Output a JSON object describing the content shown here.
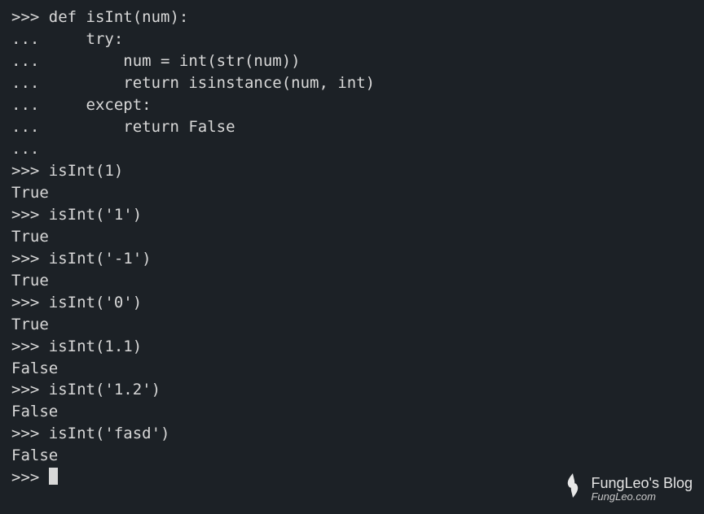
{
  "terminal": {
    "lines": [
      ">>> def isInt(num):",
      "...     try:",
      "...         num = int(str(num))",
      "...         return isinstance(num, int)",
      "...     except:",
      "...         return False",
      "...",
      ">>> isInt(1)",
      "True",
      ">>> isInt('1')",
      "True",
      ">>> isInt('-1')",
      "True",
      ">>> isInt('0')",
      "True",
      ">>> isInt(1.1)",
      "False",
      ">>> isInt('1.2')",
      "False",
      ">>> isInt('fasd')",
      "False"
    ],
    "final_prompt": ">>> "
  },
  "watermark": {
    "title": "FungLeo's Blog",
    "subtitle": "FungLeo.com"
  }
}
